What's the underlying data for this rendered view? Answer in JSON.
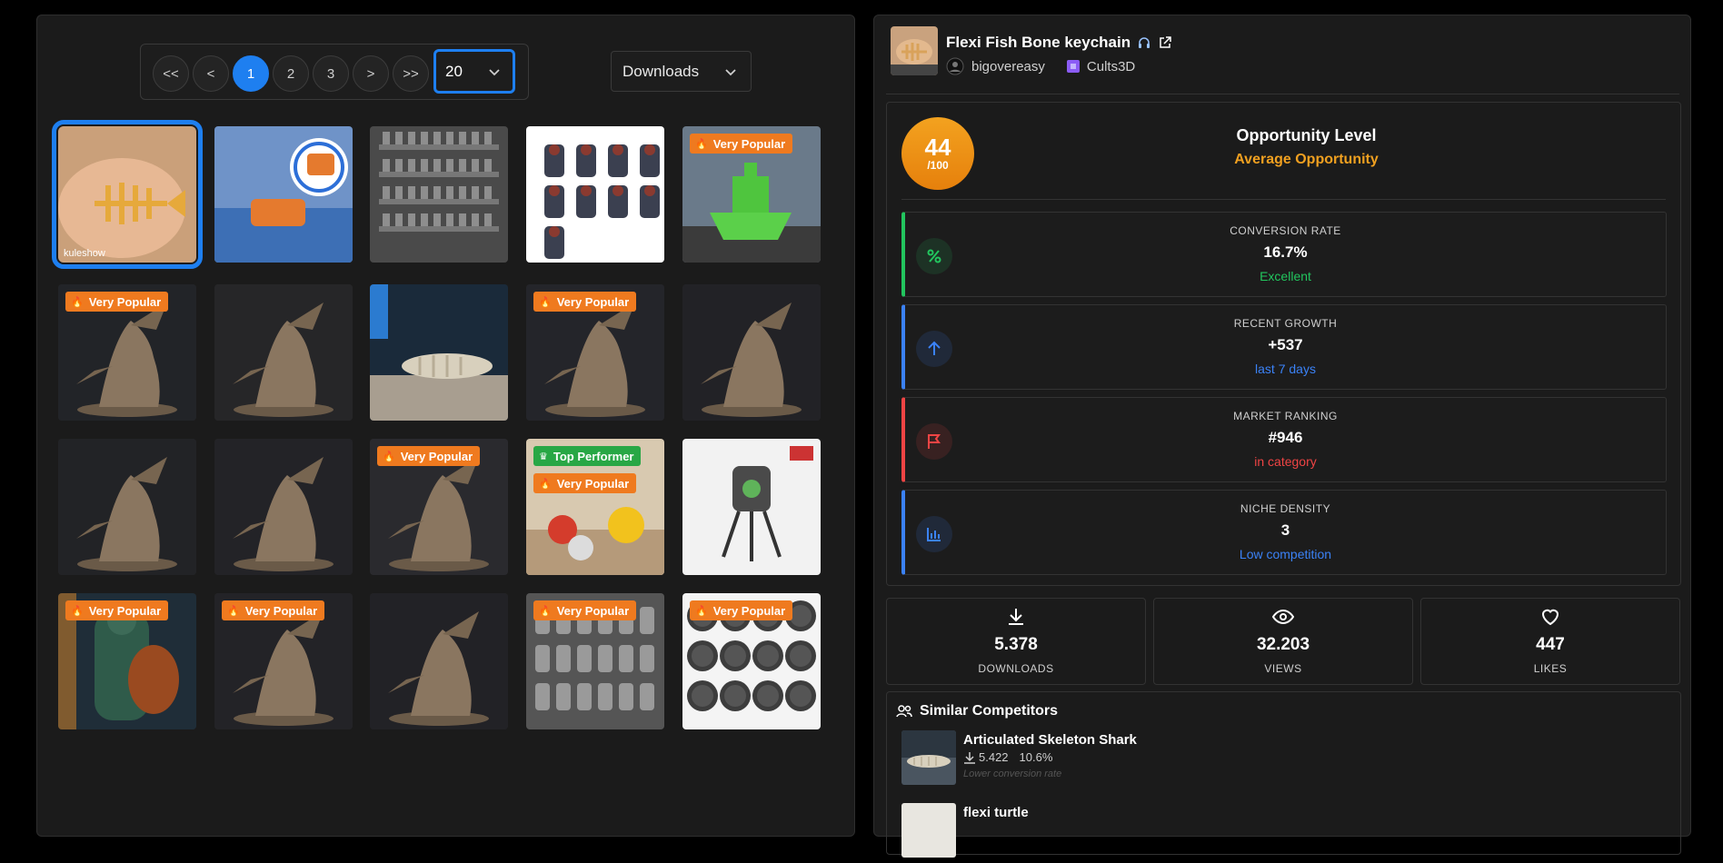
{
  "pagination": {
    "first": "<<",
    "prev": "<",
    "pages": [
      "1",
      "2",
      "3"
    ],
    "next": ">",
    "last": ">>",
    "per_page": "20"
  },
  "sort": {
    "selected": "Downloads"
  },
  "grid": {
    "tiles": [
      {
        "badges": [],
        "watermark": "kuleshow",
        "selected": true
      },
      {
        "badges": []
      },
      {
        "badges": []
      },
      {
        "badges": []
      },
      {
        "badges": [
          "Very Popular"
        ]
      },
      {
        "badges": [
          "Very Popular"
        ]
      },
      {
        "badges": []
      },
      {
        "badges": []
      },
      {
        "badges": [
          "Very Popular"
        ]
      },
      {
        "badges": []
      },
      {
        "badges": []
      },
      {
        "badges": []
      },
      {
        "badges": [
          "Very Popular"
        ]
      },
      {
        "badges": [
          "Top Performer",
          "Very Popular"
        ]
      },
      {
        "badges": []
      },
      {
        "badges": [
          "Very Popular"
        ]
      },
      {
        "badges": [
          "Very Popular"
        ]
      },
      {
        "badges": []
      },
      {
        "badges": [
          "Very Popular"
        ]
      },
      {
        "badges": [
          "Very Popular"
        ]
      }
    ]
  },
  "product": {
    "title": "Flexi Fish Bone keychain",
    "author": "bigovereasy",
    "platform": "Cults3D"
  },
  "opportunity": {
    "score": "44",
    "max": "/100",
    "label": "Opportunity Level",
    "level": "Average Opportunity"
  },
  "metrics": [
    {
      "label": "CONVERSION RATE",
      "value": "16.7%",
      "sub": "Excellent",
      "color": "#22c55e",
      "icon": "percent-icon"
    },
    {
      "label": "RECENT GROWTH",
      "value": "+537",
      "sub": "last 7 days",
      "color": "#3b82f6",
      "icon": "arrow-up-icon"
    },
    {
      "label": "MARKET RANKING",
      "value": "#946",
      "sub": "in category",
      "color": "#ef4444",
      "icon": "flag-icon"
    },
    {
      "label": "NICHE DENSITY",
      "value": "3",
      "sub": "Low competition",
      "color": "#3b82f6",
      "icon": "bar-chart-icon"
    }
  ],
  "stats": [
    {
      "value": "5.378",
      "label": "DOWNLOADS"
    },
    {
      "value": "32.203",
      "label": "VIEWS"
    },
    {
      "value": "447",
      "label": "LIKES"
    }
  ],
  "competitors": {
    "title": "Similar Competitors",
    "items": [
      {
        "name": "Articulated Skeleton Shark",
        "downloads": "5.422",
        "rate": "10.6%",
        "note": "Lower conversion rate"
      },
      {
        "name": "flexi turtle",
        "downloads": "",
        "rate": "",
        "note": ""
      }
    ]
  },
  "colors": {
    "accent": "#1e7ff0",
    "orange": "#ef7a1f",
    "green": "#28a745"
  }
}
